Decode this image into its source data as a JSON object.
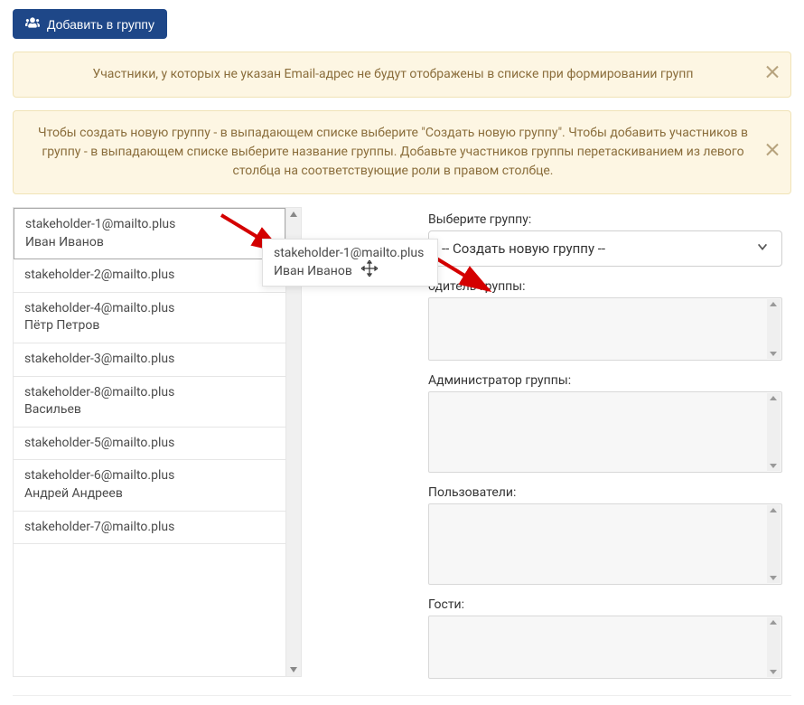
{
  "toolbar": {
    "add_to_group_label": "Добавить в группу"
  },
  "alerts": {
    "no_email_warning": "Участники, у которых не указан Email-адрес не будут отображены в списке при формировании групп",
    "howto": "Чтобы создать новую группу - в выпадающем списке выберите \"Создать новую группу\". Чтобы добавить участников в группу - в выпадающем списке выберите название группы. Добавьте участников группы перетаскиванием из левого столбца на соответствующие роли в правом столбце."
  },
  "left_list": [
    {
      "email": "stakeholder-1@mailto.plus",
      "name": "Иван Иванов",
      "selected": true
    },
    {
      "email": "stakeholder-2@mailto.plus",
      "name": ""
    },
    {
      "email": "stakeholder-4@mailto.plus",
      "name": "Пётр Петров"
    },
    {
      "email": "stakeholder-3@mailto.plus",
      "name": ""
    },
    {
      "email": "stakeholder-8@mailto.plus",
      "name": "Васильев"
    },
    {
      "email": "stakeholder-5@mailto.plus",
      "name": ""
    },
    {
      "email": "stakeholder-6@mailto.plus",
      "name": "Андрей Андреев"
    },
    {
      "email": "stakeholder-7@mailto.plus",
      "name": ""
    }
  ],
  "drag_ghost": {
    "email": "stakeholder-1@mailto.plus",
    "name": "Иван Иванов"
  },
  "group_form": {
    "select_label": "Выберите группу:",
    "select_value": "-- Создать новую группу --",
    "leader_label": "одитель группы:",
    "admin_label": "Администратор группы:",
    "users_label": "Пользователи:",
    "guests_label": "Гости:"
  }
}
